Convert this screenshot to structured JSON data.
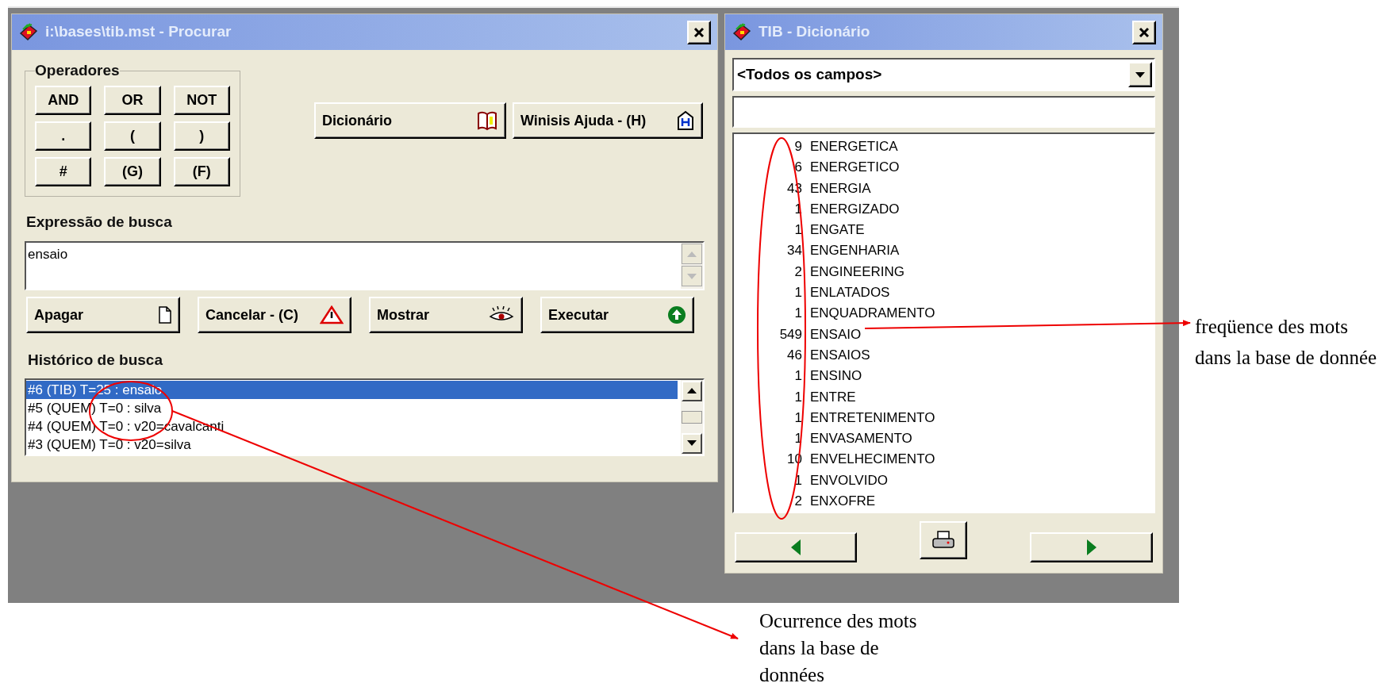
{
  "search_window": {
    "title": "i:\\bases\\tib.mst - Procurar",
    "operators_label": "Operadores",
    "operators": [
      "AND",
      "OR",
      "NOT",
      ".",
      "(",
      ")",
      "#",
      "(G)",
      "(F)"
    ],
    "tool_buttons": [
      {
        "label": "Dicionário",
        "kind": "book"
      },
      {
        "label": "Winisis Ajuda - (H)",
        "kind": "help"
      }
    ],
    "expression_label": "Expressão de busca",
    "expression_value": "ensaio",
    "action_buttons": [
      {
        "label": "Apagar",
        "kind": "document"
      },
      {
        "label": "Cancelar - (C)",
        "kind": "warning"
      },
      {
        "label": "Mostrar",
        "kind": "eye"
      },
      {
        "label": "Executar",
        "kind": "go"
      }
    ],
    "history_label": "Histórico de busca",
    "history": [
      {
        "text": "#6 (TIB) T=25 : ensaio",
        "selected": true
      },
      {
        "text": "#5 (QUEM) T=0 : silva",
        "selected": false
      },
      {
        "text": "#4 (QUEM) T=0 : v20=cavalcanti",
        "selected": false
      },
      {
        "text": "#3 (QUEM) T=0 : v20=silva",
        "selected": false
      }
    ]
  },
  "dictionary_window": {
    "title": "TIB - Dicionário",
    "field_select": "<Todos os campos>",
    "terms": [
      {
        "count": "9",
        "term": "ENERGETICA"
      },
      {
        "count": "6",
        "term": "ENERGETICO"
      },
      {
        "count": "43",
        "term": "ENERGIA"
      },
      {
        "count": "1",
        "term": "ENERGIZADO"
      },
      {
        "count": "1",
        "term": "ENGATE"
      },
      {
        "count": "34",
        "term": "ENGENHARIA"
      },
      {
        "count": "2",
        "term": "ENGINEERING"
      },
      {
        "count": "1",
        "term": "ENLATADOS"
      },
      {
        "count": "1",
        "term": "ENQUADRAMENTO"
      },
      {
        "count": "549",
        "term": "ENSAIO"
      },
      {
        "count": "46",
        "term": "ENSAIOS"
      },
      {
        "count": "1",
        "term": "ENSINO"
      },
      {
        "count": "1",
        "term": "ENTRE"
      },
      {
        "count": "1",
        "term": "ENTRETENIMENTO"
      },
      {
        "count": "1",
        "term": "ENVASAMENTO"
      },
      {
        "count": "10",
        "term": "ENVELHECIMENTO"
      },
      {
        "count": "1",
        "term": "ENVOLVIDO"
      },
      {
        "count": "2",
        "term": "ENXOFRE"
      }
    ]
  },
  "annotations": [
    {
      "text": "freqüence des mots dans la base de donnée"
    },
    {
      "text": "Ocurrence des mots dans la base de données"
    }
  ]
}
